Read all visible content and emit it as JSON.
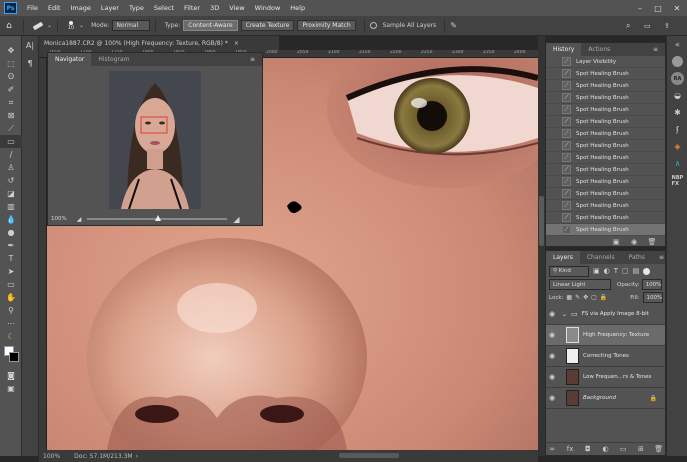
{
  "menubar": {
    "logo": "Ps",
    "items": [
      "File",
      "Edit",
      "Image",
      "Layer",
      "Type",
      "Select",
      "Filter",
      "3D",
      "View",
      "Window",
      "Help"
    ],
    "window_controls": [
      "–",
      "□",
      "✕"
    ]
  },
  "options": {
    "brush_size": "10",
    "mode_label": "Mode:",
    "mode_value": "Normal",
    "type_label": "Type:",
    "type_buttons": [
      "Content-Aware",
      "Create Texture",
      "Proximity Match"
    ],
    "sample_all_layers": "Sample All Layers"
  },
  "document": {
    "tab_title": "Monica1887.CR2 @ 100% (High Frequency: Texture, RGB/8) *",
    "ruler_marks": [
      "1650",
      "1700",
      "1750",
      "1800",
      "1850",
      "1900",
      "1950",
      "2000",
      "2050",
      "2100",
      "2150",
      "2200",
      "2250",
      "2300",
      "2350",
      "2400"
    ],
    "zoom": "100%",
    "doc_info": "Doc: 57.1M/213.3M"
  },
  "navigator": {
    "tabs": [
      "Navigator",
      "Histogram"
    ],
    "zoom": "100%"
  },
  "history": {
    "tabs": [
      "History",
      "Actions"
    ],
    "items": [
      "Layer Visibility",
      "Spot Healing Brush",
      "Spot Healing Brush",
      "Spot Healing Brush",
      "Spot Healing Brush",
      "Spot Healing Brush",
      "Spot Healing Brush",
      "Spot Healing Brush",
      "Spot Healing Brush",
      "Spot Healing Brush",
      "Spot Healing Brush",
      "Spot Healing Brush",
      "Spot Healing Brush",
      "Spot Healing Brush",
      "Spot Healing Brush"
    ]
  },
  "layers": {
    "tabs": [
      "Layers",
      "Channels",
      "Paths"
    ],
    "filter_kind": "Kind",
    "blend_mode": "Linear Light",
    "opacity_label": "Opacity:",
    "opacity_value": "100%",
    "lock_label": "Lock:",
    "fill_label": "Fill:",
    "fill_value": "100%",
    "items": [
      {
        "name": "FS via Apply Image 8-bit",
        "type": "group"
      },
      {
        "name": "High Frequency: Texture",
        "type": "layer"
      },
      {
        "name": "Correcting Tones",
        "type": "layer"
      },
      {
        "name": "Low Frequen...rs & Tones",
        "type": "layer"
      },
      {
        "name": "Background",
        "type": "background"
      }
    ]
  },
  "colors": {
    "accent": "#31a8ff",
    "panel": "#535353",
    "dark": "#424242"
  }
}
